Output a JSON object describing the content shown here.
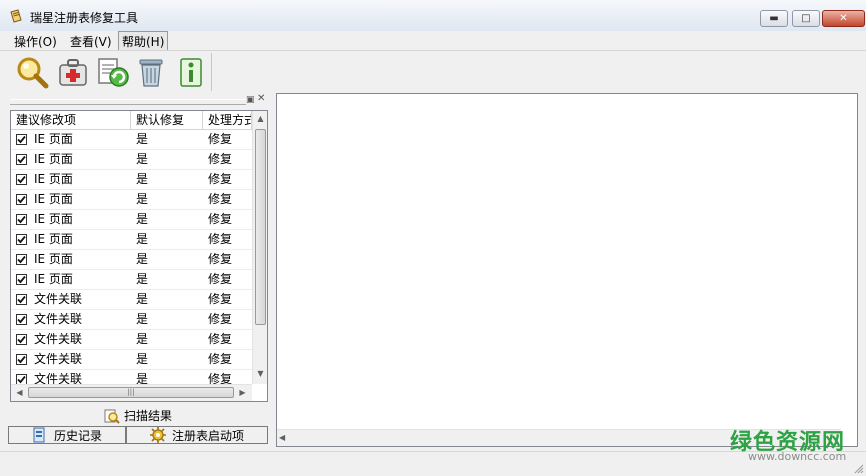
{
  "window": {
    "title": "瑞星注册表修复工具"
  },
  "menu": [
    {
      "label": "操作(O)"
    },
    {
      "label": "查看(V)"
    },
    {
      "label": "帮助(H)"
    }
  ],
  "toolbar": {
    "buttons": [
      {
        "icon": "magnifier-scan-icon"
      },
      {
        "icon": "medical-kit-repair-icon"
      },
      {
        "icon": "document-restore-icon"
      },
      {
        "icon": "trash-can-icon"
      },
      {
        "icon": "info-icon"
      }
    ]
  },
  "list": {
    "columns": [
      "建议修改项",
      "默认修复",
      "处理方式"
    ],
    "rows": [
      {
        "checked": true,
        "item": "IE 页面",
        "default": "是",
        "action": "修复"
      },
      {
        "checked": true,
        "item": "IE 页面",
        "default": "是",
        "action": "修复"
      },
      {
        "checked": true,
        "item": "IE 页面",
        "default": "是",
        "action": "修复"
      },
      {
        "checked": true,
        "item": "IE 页面",
        "default": "是",
        "action": "修复"
      },
      {
        "checked": true,
        "item": "IE 页面",
        "default": "是",
        "action": "修复"
      },
      {
        "checked": true,
        "item": "IE 页面",
        "default": "是",
        "action": "修复"
      },
      {
        "checked": true,
        "item": "IE 页面",
        "default": "是",
        "action": "修复"
      },
      {
        "checked": true,
        "item": "IE 页面",
        "default": "是",
        "action": "修复"
      },
      {
        "checked": true,
        "item": "文件关联",
        "default": "是",
        "action": "修复"
      },
      {
        "checked": true,
        "item": "文件关联",
        "default": "是",
        "action": "修复"
      },
      {
        "checked": true,
        "item": "文件关联",
        "default": "是",
        "action": "修复"
      },
      {
        "checked": true,
        "item": "文件关联",
        "default": "是",
        "action": "修复"
      },
      {
        "checked": true,
        "item": "文件关联",
        "default": "是",
        "action": "修复"
      }
    ]
  },
  "bottom": {
    "scan_result": "扫描结果",
    "tab_history": "历史记录",
    "tab_startup": "注册表启动项"
  },
  "watermark": {
    "text": "绿色资源网",
    "url": "www.downcc.com"
  },
  "colors": {
    "accent_green": "#2da343",
    "close_red": "#c4452b"
  }
}
